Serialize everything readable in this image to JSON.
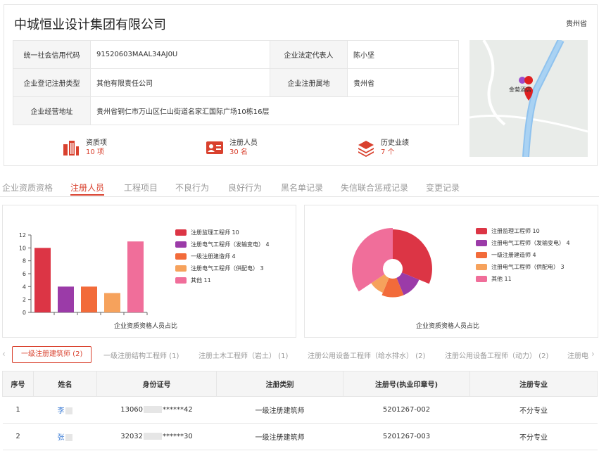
{
  "company": {
    "name": "中城恒业设计集团有限公司",
    "province": "贵州省"
  },
  "info": {
    "credit_code_label": "统一社会信用代码",
    "credit_code": "91520603MAAL34AJ0U",
    "legal_rep_label": "企业法定代表人",
    "legal_rep": "陈小坚",
    "reg_type_label": "企业登记注册类型",
    "reg_type": "其他有限责任公司",
    "reg_place_label": "企业注册属地",
    "reg_place": "贵州省",
    "address_label": "企业经营地址",
    "address": "贵州省铜仁市万山区仁山街道名家汇国际广场10栋16层"
  },
  "stats": [
    {
      "label": "资质项",
      "value": "10 项",
      "icon": "building-icon"
    },
    {
      "label": "注册人员",
      "value": "30 名",
      "icon": "id-card-icon"
    },
    {
      "label": "历史业绩",
      "value": "7 个",
      "icon": "layers-icon"
    }
  ],
  "map": {
    "poi_label": "金菊酒店"
  },
  "tabs": [
    "企业资质资格",
    "注册人员",
    "工程项目",
    "不良行为",
    "良好行为",
    "黑名单记录",
    "失信联合惩戒记录",
    "变更记录"
  ],
  "active_tab": 1,
  "chart_data": [
    {
      "type": "bar",
      "categories": [
        "注册监理工程师",
        "注册电气工程师（发输变电）",
        "一级注册建造师",
        "注册电气工程师（供配电）",
        "其他"
      ],
      "values": [
        10,
        4,
        4,
        3,
        11
      ],
      "colors": [
        "#dc3545",
        "#9b3ba8",
        "#f26b3a",
        "#f6a25c",
        "#f06e9a"
      ],
      "legend": [
        "注册监理工程师 10",
        "注册电气工程师（发输变电） 4",
        "一级注册建造师 4",
        "注册电气工程师（供配电） 3",
        "其他 11"
      ],
      "ylim": [
        0,
        12
      ],
      "yticks": [
        "0",
        "2",
        "4",
        "6",
        "8",
        "10",
        "12"
      ],
      "title": "企业资质资格人员占比"
    },
    {
      "type": "pie",
      "variant": "rose",
      "categories": [
        "注册监理工程师",
        "注册电气工程师（发输变电）",
        "一级注册建造师",
        "注册电气工程师（供配电）",
        "其他"
      ],
      "values": [
        10,
        4,
        4,
        3,
        11
      ],
      "colors": [
        "#dc3545",
        "#9b3ba8",
        "#f26b3a",
        "#f6a25c",
        "#f06e9a"
      ],
      "legend": [
        "注册监理工程师 10",
        "注册电气工程师（发输变电） 4",
        "一级注册建造师 4",
        "注册电气工程师（供配电） 3",
        "其他 11"
      ],
      "title": "企业资质资格人员占比"
    }
  ],
  "subtabs": [
    "一级注册建筑师 (2)",
    "一级注册结构工程师 (1)",
    "注册土木工程师（岩土） (1)",
    "注册公用设备工程师（给水排水） (2)",
    "注册公用设备工程师（动力） (2)",
    "注册电"
  ],
  "table": {
    "headers": [
      "序号",
      "姓名",
      "身份证号",
      "注册类别",
      "注册号(执业印章号)",
      "注册专业"
    ],
    "rows": [
      {
        "no": "1",
        "name": "李",
        "id_prefix": "13060",
        "id_suffix": "******42",
        "category": "一级注册建筑师",
        "reg_no": "5201267-002",
        "major": "不分专业"
      },
      {
        "no": "2",
        "name": "张",
        "id_prefix": "32032",
        "id_suffix": "******30",
        "category": "一级注册建筑师",
        "reg_no": "5201267-003",
        "major": "不分专业"
      }
    ]
  }
}
